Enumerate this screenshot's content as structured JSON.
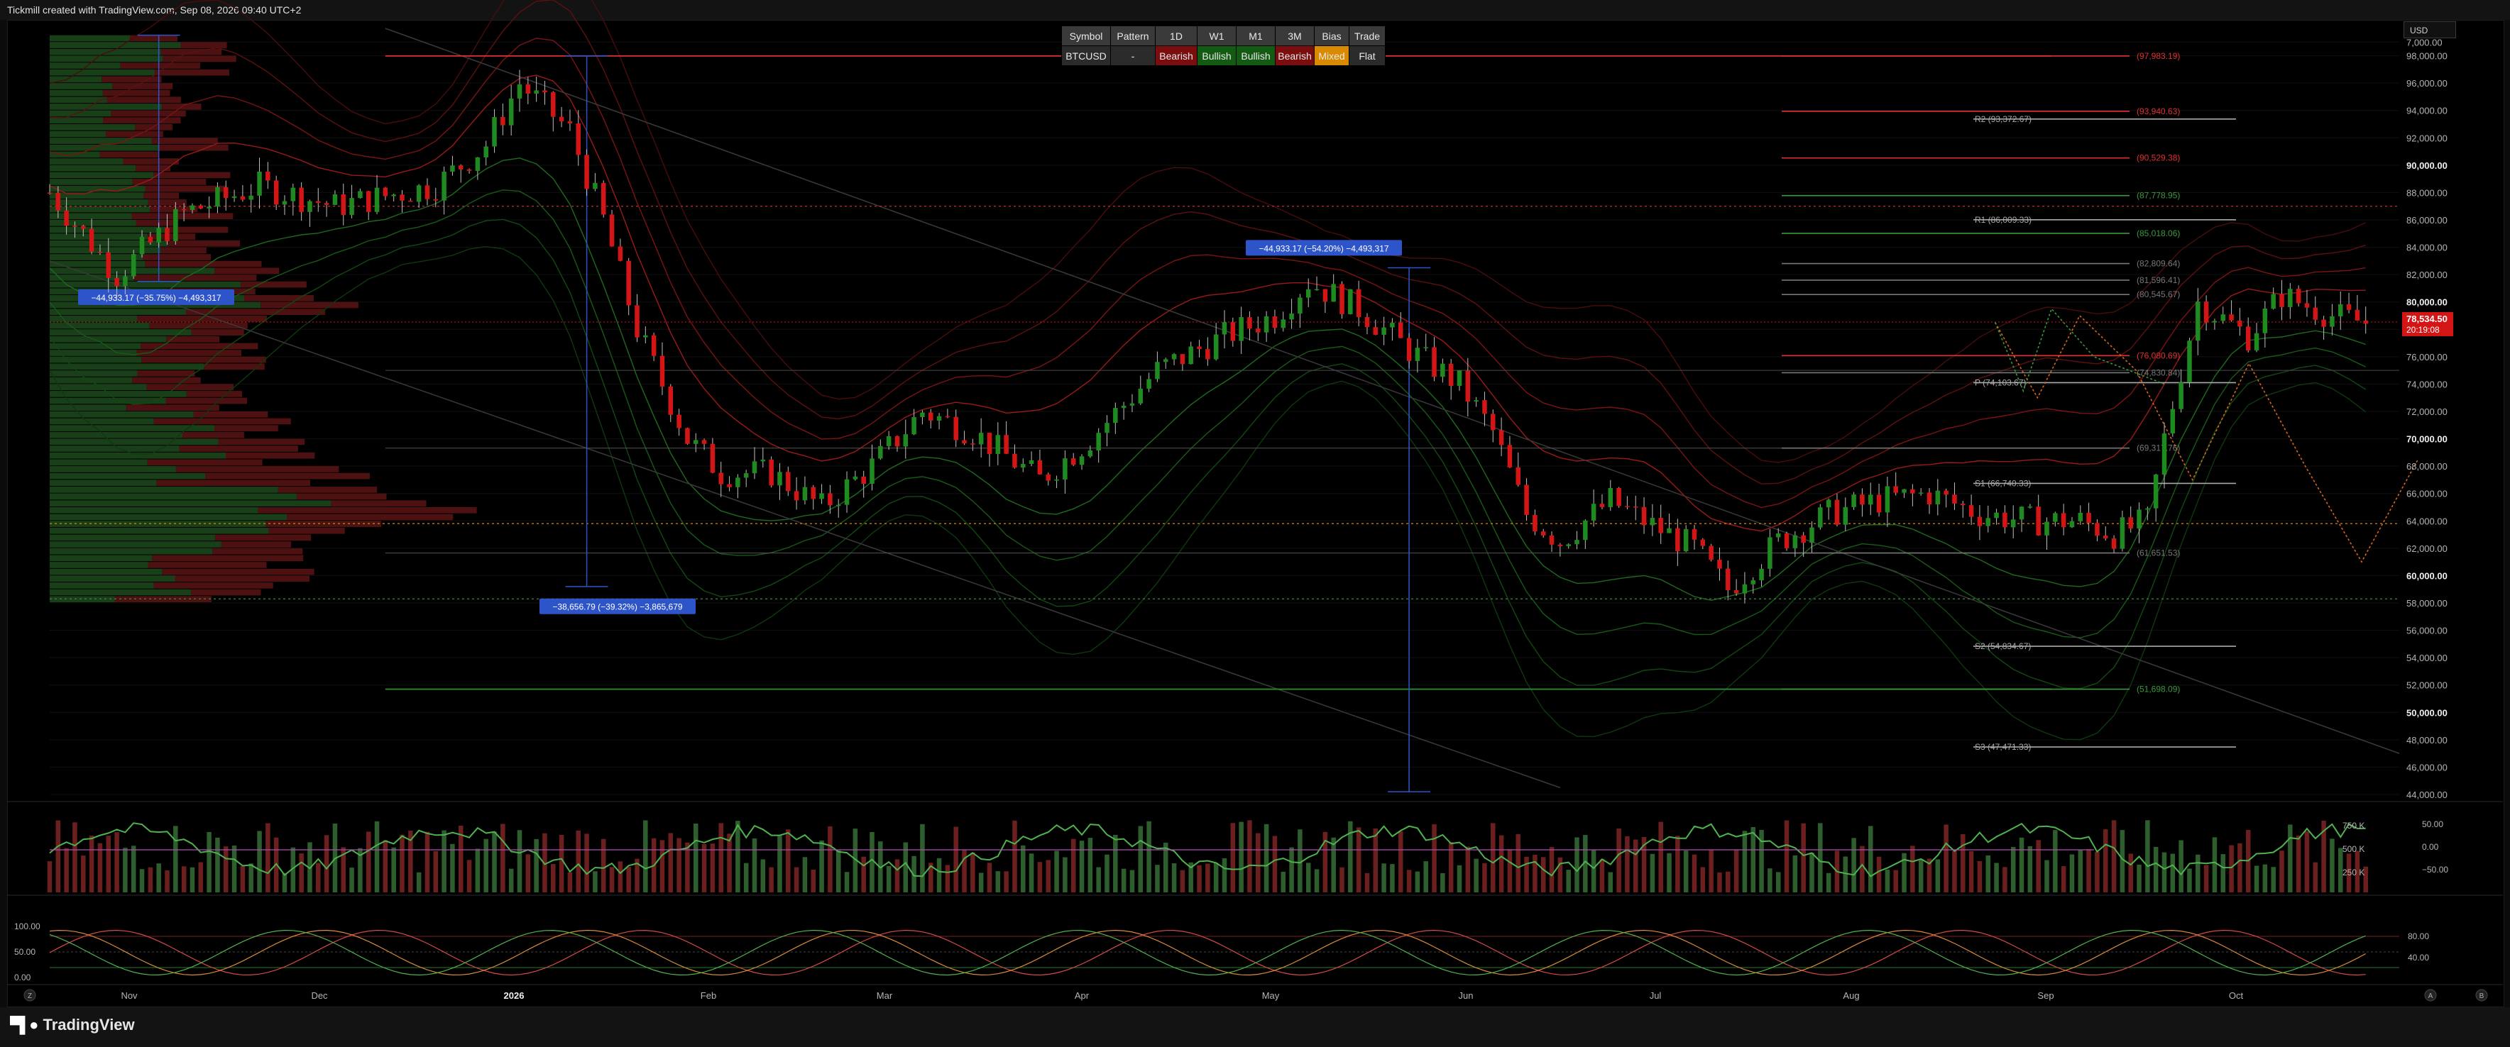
{
  "header": {
    "credit": "Tickmill created with TradingView.com, Sep 08, 2026 09:40 UTC+2"
  },
  "footer": {
    "brand": "TradingView",
    "left_button": "Z",
    "right_buttons": [
      "A",
      "B"
    ]
  },
  "currency_selector": "USD",
  "bias_table": {
    "headers": [
      "Symbol",
      "Pattern",
      "1D",
      "W1",
      "M1",
      "3M",
      "Bias",
      "Trade"
    ],
    "values": [
      "BTCUSD",
      "-",
      "Bearish",
      "Bullish",
      "Bullish",
      "Bearish",
      "Mixed",
      "Flat"
    ]
  },
  "chart_data": {
    "type": "candlestick",
    "symbol": "BTCUSD",
    "ylim": [
      44000,
      100000
    ],
    "price_ticks": [
      "7,000.00",
      "98,000.00",
      "96,000.00",
      "94,000.00",
      "92,000.00",
      "90,000.00",
      "88,000.00",
      "86,000.00",
      "84,000.00",
      "82,000.00",
      "80,000.00",
      "78,000.00",
      "76,000.00",
      "74,000.00",
      "72,000.00",
      "70,000.00",
      "68,000.00",
      "66,000.00",
      "64,000.00",
      "62,000.00",
      "60,000.00",
      "58,000.00",
      "56,000.00",
      "54,000.00",
      "52,000.00",
      "50,000.00",
      "48,000.00",
      "46,000.00",
      "44,000.00"
    ],
    "price_tick_values": [
      99000,
      98000,
      96000,
      94000,
      92000,
      90000,
      88000,
      86000,
      84000,
      82000,
      80000,
      78000,
      76000,
      74000,
      72000,
      70000,
      68000,
      66000,
      64000,
      62000,
      60000,
      58000,
      56000,
      54000,
      52000,
      50000,
      48000,
      46000,
      44000
    ],
    "bold_ticks": [
      "90,000.00",
      "80,000.00",
      "70,000.00",
      "60,000.00",
      "50,000.00"
    ],
    "time_labels": [
      "Nov",
      "Dec",
      "2026",
      "Feb",
      "Mar",
      "Apr",
      "May",
      "Jun",
      "Jul",
      "Aug",
      "Sep",
      "Oct"
    ],
    "current_price": {
      "value": "78,534.50",
      "countdown": "20:19:08",
      "raw": 78534.5
    },
    "price_path": [
      [
        0,
        88000
      ],
      [
        8,
        82000
      ],
      [
        16,
        86500
      ],
      [
        25,
        88500
      ],
      [
        34,
        87000
      ],
      [
        46,
        88500
      ],
      [
        52,
        91500
      ],
      [
        56,
        96000
      ],
      [
        62,
        92500
      ],
      [
        66,
        86000
      ],
      [
        70,
        78000
      ],
      [
        76,
        70000
      ],
      [
        80,
        67500
      ],
      [
        86,
        67500
      ],
      [
        92,
        65000
      ],
      [
        98,
        68000
      ],
      [
        104,
        72000
      ],
      [
        110,
        70500
      ],
      [
        118,
        67000
      ],
      [
        124,
        70000
      ],
      [
        132,
        75000
      ],
      [
        140,
        77500
      ],
      [
        146,
        79000
      ],
      [
        150,
        81500
      ],
      [
        156,
        79500
      ],
      [
        162,
        76500
      ],
      [
        168,
        74000
      ],
      [
        172,
        70500
      ],
      [
        176,
        64500
      ],
      [
        180,
        62500
      ],
      [
        186,
        65500
      ],
      [
        190,
        64000
      ],
      [
        196,
        62000
      ],
      [
        200,
        59000
      ],
      [
        206,
        62500
      ],
      [
        212,
        64500
      ],
      [
        218,
        65500
      ],
      [
        224,
        66000
      ],
      [
        230,
        64500
      ],
      [
        236,
        64000
      ],
      [
        242,
        64000
      ],
      [
        246,
        63000
      ],
      [
        250,
        64000
      ],
      [
        252,
        70000
      ],
      [
        256,
        80000
      ],
      [
        262,
        77500
      ],
      [
        266,
        80500
      ],
      [
        272,
        79000
      ],
      [
        276,
        78500
      ]
    ],
    "horizontal_levels": [
      {
        "label": "(97,983.19)",
        "value": 97983.19,
        "color": "#e03030"
      },
      {
        "label": "R2 (93,372.67)",
        "value": 93372.67,
        "color": "#aaaaaa"
      },
      {
        "label": "(93,940.63)",
        "value": 93940.63,
        "color": "#e03030"
      },
      {
        "label": "(90,529.38)",
        "value": 90529.38,
        "color": "#e03030"
      },
      {
        "label": "(87,778.95)",
        "value": 87778.95,
        "color": "#3a9a3a"
      },
      {
        "label": "R1 (86,009.33)",
        "value": 86009.33,
        "color": "#aaaaaa"
      },
      {
        "label": "(85,018.06)",
        "value": 85018.06,
        "color": "#3a9a3a"
      },
      {
        "label": "(82,809.64)",
        "value": 82809.64,
        "color": "#777777"
      },
      {
        "label": "(81,596.41)",
        "value": 81596.41,
        "color": "#777777"
      },
      {
        "label": "(80,545.67)",
        "value": 80545.67,
        "color": "#777777"
      },
      {
        "label": "(76,080.69)",
        "value": 76080.69,
        "color": "#e03030"
      },
      {
        "label": "(74,830.84)",
        "value": 74830.84,
        "color": "#777777"
      },
      {
        "label": "P (74,103.67)",
        "value": 74103.67,
        "color": "#aaaaaa"
      },
      {
        "label": "(69,317.76)",
        "value": 69317.76,
        "color": "#777777"
      },
      {
        "label": "S1 (66,740.33)",
        "value": 66740.33,
        "color": "#aaaaaa"
      },
      {
        "label": "(61,651.53)",
        "value": 61651.53,
        "color": "#777777"
      },
      {
        "label": "S2 (54,834.67)",
        "value": 54834.67,
        "color": "#aaaaaa"
      },
      {
        "label": "(51,698.09)",
        "value": 51698.09,
        "color": "#3a9a3a"
      },
      {
        "label": "S3 (47,471.33)",
        "value": 47471.33,
        "color": "#aaaaaa"
      }
    ],
    "measure_labels": [
      {
        "text": "−44,933.17 (−35.75%) −4,493,317",
        "price": 80000
      },
      {
        "text": "−44,933.17 (−54.20%) −4,493,317",
        "price": 83000
      },
      {
        "text": "−38,656.79 (−39.32%) −3,865,679",
        "price": 58000
      }
    ],
    "volume_axis": [
      "750 K",
      "500 K",
      "250 K"
    ],
    "osc_axis_right": [
      "50.00",
      "0.00",
      "−50.00"
    ],
    "stoch_axis_left": [
      "100.00",
      "50.00",
      "0.00"
    ],
    "stoch_axis_right": [
      "80.00",
      "40.00"
    ],
    "colors": {
      "bull": "#1f8a1f",
      "bear": "#d41515",
      "volume_bull": "#2e5e2e",
      "volume_bear": "#6b1f1f",
      "current_price_bg": "#d41515"
    }
  }
}
